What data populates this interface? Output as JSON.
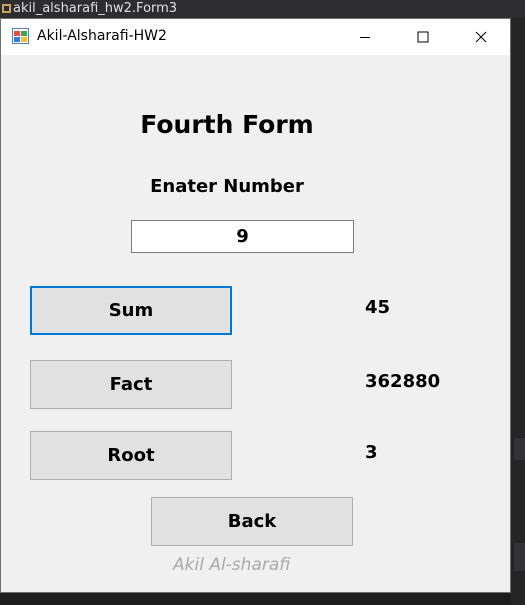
{
  "ide": {
    "tab_title": "akil_alsharafi_hw2.Form3"
  },
  "window": {
    "title": "Akil-Alsharafi-HW2",
    "controls": {
      "minimize": "minimize-icon",
      "maximize": "maximize-icon",
      "close": "close-icon"
    }
  },
  "form": {
    "heading": "Fourth Form",
    "prompt": "Enater Number",
    "input_value": "9",
    "buttons": {
      "sum": "Sum",
      "fact": "Fact",
      "root": "Root",
      "back": "Back"
    },
    "results": {
      "sum": "45",
      "fact": "362880",
      "root": "3"
    },
    "signature": "Akil Al-sharafi"
  },
  "colors": {
    "focus_border": "#0078d7",
    "form_background": "#f0f0f0",
    "signature_text": "#a9a9a9"
  }
}
